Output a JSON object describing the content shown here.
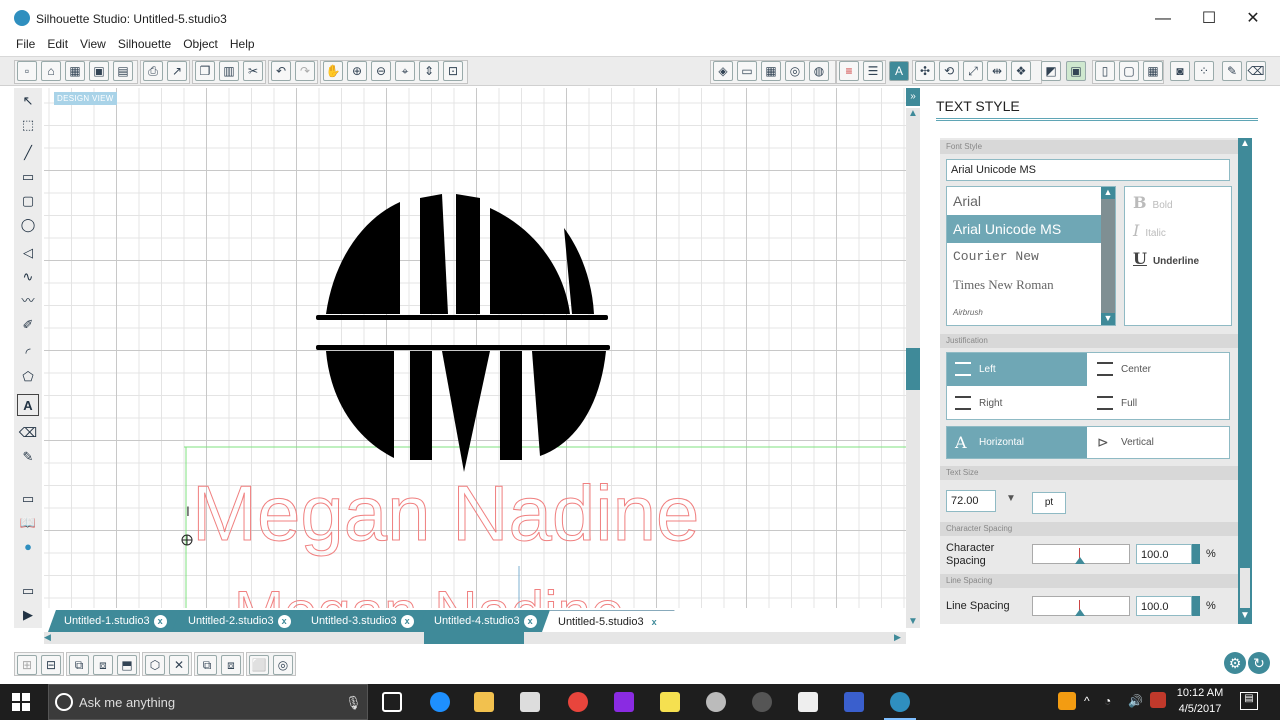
{
  "window": {
    "title": "Silhouette Studio: Untitled-5.studio3",
    "minimize": "—",
    "maximize": "☐",
    "close": "✕"
  },
  "menu": [
    "File",
    "Edit",
    "View",
    "Silhouette",
    "Object",
    "Help"
  ],
  "canvas": {
    "design_view_label": "DESIGN VIEW",
    "text_object": "Megan Nadine",
    "monogram_top": "MLN",
    "monogram_bottom": "MLN"
  },
  "doc_tabs": [
    {
      "label": "Untitled-1.studio3",
      "close": "x"
    },
    {
      "label": "Untitled-2.studio3",
      "close": "x"
    },
    {
      "label": "Untitled-3.studio3",
      "close": "x"
    },
    {
      "label": "Untitled-4.studio3",
      "close": "x"
    },
    {
      "label": "Untitled-5.studio3",
      "close": "x",
      "active": true
    }
  ],
  "panel": {
    "title": "TEXT STYLE",
    "font_style": {
      "section": "Font Style",
      "current_font": "Arial Unicode MS",
      "fonts": [
        "Arial",
        "Arial Unicode MS",
        "Courier New",
        "Times New Roman",
        "Airbrush"
      ],
      "selected_font": "Arial Unicode MS",
      "bold": "Bold",
      "italic": "Italic",
      "underline": "Underline"
    },
    "justification": {
      "section": "Justification",
      "left": "Left",
      "center": "Center",
      "right": "Right",
      "full": "Full",
      "selected": "Left"
    },
    "orientation": {
      "horizontal": "Horizontal",
      "vertical": "Vertical",
      "selected": "Horizontal"
    },
    "text_size": {
      "section": "Text Size",
      "value": "72.00",
      "unit": "pt"
    },
    "character_spacing": {
      "section": "Character Spacing",
      "label": "Character Spacing",
      "value": "100.0",
      "unit": "%",
      "level": 0.5
    },
    "line_spacing": {
      "section": "Line Spacing",
      "label": "Line Spacing",
      "value": "100.0",
      "unit": "%",
      "level": 0.5
    }
  },
  "taskbar": {
    "search_placeholder": "Ask me anything",
    "time": "10:12 AM",
    "date": "4/5/2017"
  },
  "colors": {
    "accent": "#3f8a99",
    "selected": "#6fa7b5",
    "text_outline": "#f08080"
  }
}
